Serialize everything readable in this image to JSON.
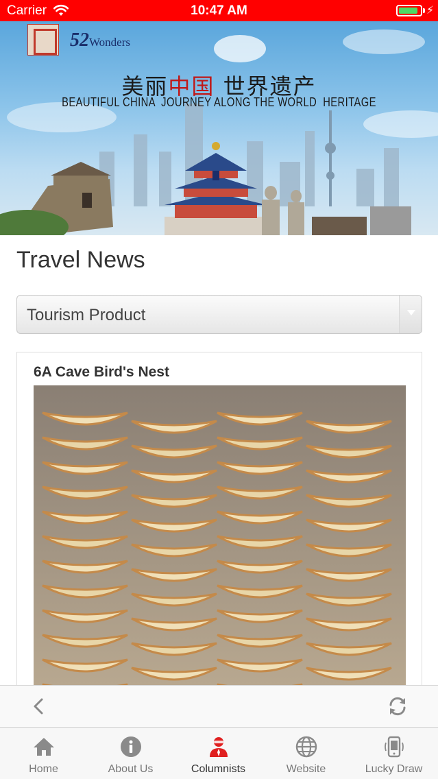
{
  "status_bar": {
    "carrier": "Carrier",
    "time": "10:47 AM",
    "battery_level": 0.9,
    "color": "#ff0000"
  },
  "banner": {
    "brand_number": "52",
    "brand_word": "Wonders",
    "title_cn_prefix": "美丽",
    "title_cn_highlight": "中国",
    "title_cn_suffix": " 世界遗产",
    "title_en": "BEAUTIFUL CHINA  JOURNEY ALONG THE WORLD  HERITAGE"
  },
  "page": {
    "title": "Travel News"
  },
  "filter": {
    "selected": "Tourism Product"
  },
  "article": {
    "title": "6A Cave Bird's Nest"
  },
  "toolbar": {
    "back_icon": "chevron-left-icon",
    "refresh_icon": "refresh-icon"
  },
  "tabs": [
    {
      "label": "Home",
      "icon": "home-icon",
      "active": false
    },
    {
      "label": "About Us",
      "icon": "info-icon",
      "active": false
    },
    {
      "label": "Columnists",
      "icon": "person-icon",
      "active": true
    },
    {
      "label": "Website",
      "icon": "globe-icon",
      "active": false
    },
    {
      "label": "Lucky Draw",
      "icon": "phone-draw-icon",
      "active": false
    }
  ],
  "colors": {
    "accent": "#e02020",
    "tab_inactive": "#777777",
    "tab_active": "#333333"
  }
}
